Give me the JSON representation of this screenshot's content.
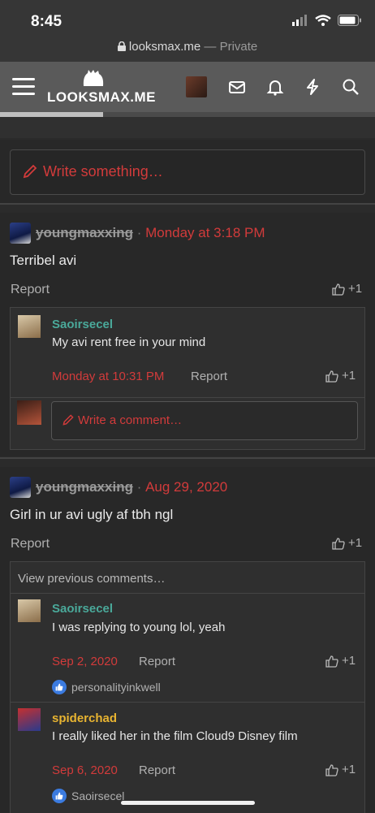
{
  "status": {
    "time": "8:45"
  },
  "browser": {
    "url": "looksmax.me",
    "separator": " — ",
    "mode": "Private"
  },
  "nav": {
    "logo_text": "LOOKSMAX.ME"
  },
  "composer": {
    "placeholder": "Write something…"
  },
  "posts": [
    {
      "author": "youngmaxxing",
      "sep": " · ",
      "date": "Monday at 3:18 PM",
      "body": "Terribel avi",
      "report": "Report",
      "like": "+1",
      "comments": [
        {
          "author": "Saoirsecel",
          "text": "My avi rent free in your mind",
          "date": "Monday at 10:31 PM",
          "report": "Report",
          "like": "+1"
        }
      ],
      "comment_placeholder": "Write a comment…"
    },
    {
      "author": "youngmaxxing",
      "sep": " · ",
      "date": "Aug 29, 2020",
      "body": "Girl in ur avi ugly af tbh ngl",
      "report": "Report",
      "like": "+1",
      "view_previous": "View previous comments…",
      "comments": [
        {
          "author": "Saoirsecel",
          "text": "I was replying to young lol, yeah",
          "date": "Sep 2, 2020",
          "report": "Report",
          "like": "+1",
          "liked_by": "personalityinkwell"
        },
        {
          "author": "spiderchad",
          "text": "I really liked her in the film Cloud9 Disney film",
          "date": "Sep 6, 2020",
          "report": "Report",
          "like": "+1",
          "liked_by": "Saoirsecel"
        }
      ]
    }
  ],
  "colors": {
    "accent_red": "#d23b3b",
    "name_teal": "#4aa99a",
    "name_yellow": "#e8b431",
    "like_blue": "#3b7be0"
  },
  "icons": [
    "signal-icon",
    "wifi-icon",
    "battery-icon",
    "lock-icon",
    "menu-icon",
    "mail-icon",
    "bell-icon",
    "bolt-icon",
    "search-icon",
    "pencil-icon",
    "thumb-up-icon"
  ]
}
